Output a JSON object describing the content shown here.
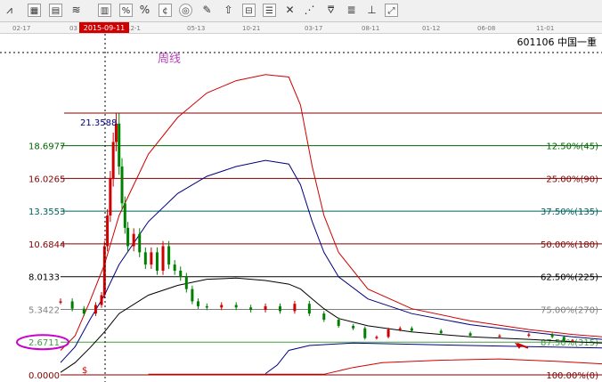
{
  "toolbar": {
    "icons": [
      "line-tool",
      "grid-tool",
      "table-tool",
      "trend-tool",
      "bar-tool",
      "percent-tool",
      "percent-box-tool",
      "coin-tool",
      "target-tool",
      "pen-tool",
      "cross-tool",
      "arrow-tool",
      "compare-tool",
      "ladder-tool",
      "stair-tool",
      "fan-tool"
    ],
    "percent_label": "%"
  },
  "date_axis": {
    "labels": [
      "02-17",
      "03",
      "12-1",
      "05-13",
      "10-21",
      "03-17",
      "08-11",
      "01-12",
      "06-08",
      "11-01"
    ],
    "cursor_date": "2015-09-11"
  },
  "stock": {
    "code": "601106",
    "name": "中国一重"
  },
  "weekly_label": "周线",
  "high_label": "21.3588",
  "dollar_label": "$",
  "colors": {
    "red": "#d00000",
    "navy": "#000080",
    "green": "#006400",
    "purple": "#bb44bb",
    "magenta": "#cc00cc"
  },
  "chart_data": {
    "type": "line",
    "title": "",
    "xlabel": "",
    "ylabel": "",
    "ylim": [
      0,
      21.3588
    ],
    "price_labels": [
      "18.6977",
      "16.0265",
      "13.3553",
      "10.6844",
      "8.0133",
      "5.3422",
      "2.6711",
      "0.0000"
    ],
    "price_values": [
      18.6977,
      16.0265,
      13.3553,
      10.6844,
      8.0133,
      5.3422,
      2.6711,
      0.0
    ],
    "fib_labels": [
      "12.50%(45)",
      "25.00%(90)",
      "37.50%(135)",
      "50.00%(180)",
      "62.50%(225)",
      "75.00%(270)",
      "87.50%(315)",
      "100.00%(0)"
    ],
    "fib_colors": [
      "#006400",
      "#800000",
      "#006060",
      "#800000",
      "#000000",
      "#808080",
      "#40a040",
      "#800000"
    ],
    "band_upper": [
      [
        0,
        2
      ],
      [
        5,
        3.2
      ],
      [
        10,
        6
      ],
      [
        15,
        9
      ],
      [
        20,
        13
      ],
      [
        30,
        18
      ],
      [
        40,
        21
      ],
      [
        50,
        23
      ],
      [
        60,
        24
      ],
      [
        70,
        24.5
      ],
      [
        78,
        24.3
      ],
      [
        82,
        22
      ],
      [
        86,
        17
      ],
      [
        90,
        13
      ],
      [
        95,
        10
      ],
      [
        105,
        7
      ],
      [
        120,
        5.4
      ],
      [
        140,
        4.4
      ],
      [
        160,
        3.7
      ],
      [
        175,
        3.3
      ],
      [
        185,
        3.1
      ]
    ],
    "band_mid": [
      [
        0,
        1
      ],
      [
        5,
        2.3
      ],
      [
        10,
        4.5
      ],
      [
        15,
        6.5
      ],
      [
        20,
        9
      ],
      [
        30,
        12.5
      ],
      [
        40,
        14.8
      ],
      [
        50,
        16.2
      ],
      [
        60,
        17
      ],
      [
        70,
        17.5
      ],
      [
        78,
        17.2
      ],
      [
        82,
        15.5
      ],
      [
        86,
        12.5
      ],
      [
        90,
        10
      ],
      [
        95,
        8
      ],
      [
        105,
        6.2
      ],
      [
        120,
        5
      ],
      [
        140,
        4.1
      ],
      [
        160,
        3.5
      ],
      [
        175,
        3.1
      ],
      [
        185,
        2.9
      ]
    ],
    "band_lower": [
      [
        0,
        0.2
      ],
      [
        5,
        1
      ],
      [
        10,
        2.2
      ],
      [
        15,
        3.5
      ],
      [
        20,
        5
      ],
      [
        30,
        6.5
      ],
      [
        40,
        7.3
      ],
      [
        50,
        7.8
      ],
      [
        60,
        7.9
      ],
      [
        70,
        7.7
      ],
      [
        78,
        7.4
      ],
      [
        82,
        7
      ],
      [
        86,
        6.2
      ],
      [
        90,
        5.4
      ],
      [
        95,
        4.6
      ],
      [
        105,
        4
      ],
      [
        120,
        3.5
      ],
      [
        140,
        3.1
      ],
      [
        160,
        2.9
      ],
      [
        175,
        2.7
      ],
      [
        185,
        2.6
      ]
    ],
    "red_lower": [
      [
        30,
        0.05
      ],
      [
        60,
        0.05
      ],
      [
        70,
        0.05
      ],
      [
        90,
        0.05
      ],
      [
        100,
        0.6
      ],
      [
        110,
        1
      ],
      [
        130,
        1.2
      ],
      [
        150,
        1.3
      ],
      [
        170,
        1.1
      ],
      [
        185,
        0.9
      ]
    ],
    "blue_lower": [
      [
        70,
        0.1
      ],
      [
        74,
        0.8
      ],
      [
        78,
        2
      ],
      [
        85,
        2.4
      ],
      [
        100,
        2.6
      ],
      [
        120,
        2.5
      ],
      [
        140,
        2.4
      ],
      [
        160,
        2.3
      ],
      [
        185,
        2.2
      ]
    ],
    "candles_approx_close": [
      [
        0,
        6.0
      ],
      [
        4,
        5.4
      ],
      [
        8,
        5.0
      ],
      [
        12,
        5.7
      ],
      [
        14,
        6.5
      ],
      [
        15,
        10.5
      ],
      [
        16,
        13.0
      ],
      [
        17,
        16.0
      ],
      [
        18,
        19.0
      ],
      [
        19,
        20.5
      ],
      [
        20,
        17.0
      ],
      [
        21,
        14.0
      ],
      [
        22,
        12.0
      ],
      [
        23,
        10.5
      ],
      [
        25,
        11.5
      ],
      [
        27,
        10.0
      ],
      [
        29,
        9.0
      ],
      [
        31,
        10.0
      ],
      [
        33,
        8.5
      ],
      [
        35,
        10.5
      ],
      [
        37,
        9.0
      ],
      [
        39,
        8.5
      ],
      [
        41,
        8.0
      ],
      [
        43,
        7.0
      ],
      [
        45,
        6.0
      ],
      [
        47,
        5.6
      ],
      [
        50,
        5.5
      ],
      [
        55,
        5.7
      ],
      [
        60,
        5.5
      ],
      [
        65,
        5.3
      ],
      [
        70,
        5.6
      ],
      [
        75,
        5.2
      ],
      [
        80,
        5.8
      ],
      [
        85,
        5.0
      ],
      [
        90,
        4.5
      ],
      [
        95,
        4.0
      ],
      [
        100,
        3.8
      ],
      [
        104,
        3.0
      ],
      [
        108,
        3.1
      ],
      [
        112,
        3.7
      ],
      [
        116,
        3.8
      ],
      [
        120,
        3.6
      ],
      [
        130,
        3.4
      ],
      [
        140,
        3.2
      ],
      [
        150,
        3.2
      ],
      [
        160,
        3.3
      ],
      [
        168,
        3.1
      ],
      [
        172,
        2.8
      ],
      [
        175,
        2.8
      ]
    ]
  }
}
